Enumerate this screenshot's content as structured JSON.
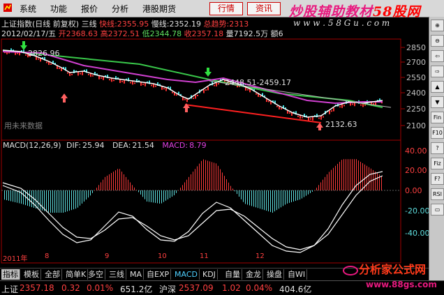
{
  "menu": {
    "items": [
      "系统",
      "功能",
      "报价",
      "分析",
      "港股期货"
    ],
    "buttons": [
      "行情",
      "资讯"
    ]
  },
  "watermark_top": {
    "text": "炒股辅助教材",
    "red": "58股网",
    "url": "w w w . 5 8 G u . c o m"
  },
  "chart_header": {
    "line1": {
      "title": "上证指数(日线 前复权) 三线",
      "l1_label": "快线:",
      "l1_value": "2355.95",
      "l2_label": "慢线:",
      "l2_value": "2352.19",
      "l3_label": "总趋势:",
      "l3_value": "2313"
    },
    "line2": {
      "date": "2012/02/17/五",
      "open_label": "开",
      "open": "2368.63",
      "high_label": "高",
      "high": "2372.51",
      "low_label": "低",
      "low": "2344.78",
      "close_label": "收",
      "close": "2357.18",
      "amt_label": "量",
      "amt": "7192.5万",
      "extra": "额6"
    }
  },
  "price_axis": [
    "2850",
    "2700",
    "2550",
    "2400",
    "2250",
    "2100"
  ],
  "annotations": {
    "top_left": "2826.96",
    "mid": "2448.51-2459.17",
    "low": "2132.63",
    "future": "用未来数据"
  },
  "macd_header": {
    "label": "MACD(12,26,9)",
    "dif_label": "DIF:",
    "dif": "25.94",
    "dea_label": "DEA:",
    "dea": "21.54",
    "macd_label": "MACD:",
    "macd": "8.79"
  },
  "macd_axis": [
    "40.00",
    "20.00",
    "0.00",
    "-20.00",
    "-40.00"
  ],
  "date_axis": [
    "2011年",
    "8",
    "9",
    "10",
    "11",
    "12"
  ],
  "tabs": [
    {
      "label": "指标",
      "active": true
    },
    {
      "label": "模板"
    },
    {
      "label": "全部"
    },
    {
      "label": "简单K"
    },
    {
      "label": "多空"
    },
    {
      "label": "三线"
    },
    {
      "label": "MA"
    },
    {
      "label": "自EXP"
    },
    {
      "label": "MACD",
      "cyan": true
    },
    {
      "label": "KDJ"
    },
    {
      "label": "自量"
    },
    {
      "label": "金龙"
    },
    {
      "label": "操盘"
    },
    {
      "label": "自WI"
    }
  ],
  "status": {
    "sh_label": "上证",
    "sh_val": "2357.18",
    "sh_chg": "0.32",
    "sh_pct": "0.01%",
    "sh_amt": "651.2亿",
    "sz_label": "沪深",
    "sz_val": "2537.09",
    "sz_chg": "1.02",
    "sz_pct": "0.04%",
    "sz_amt": "404.6亿"
  },
  "watermark_bottom": {
    "title": "分析家公式网",
    "url": "www.88gs.com"
  },
  "right_toolbar": [
    "⊕",
    "⊖",
    "⇦",
    "⇨",
    "▲",
    "▼",
    "Fin",
    "F10",
    "?",
    "Fiz",
    "F?",
    "RSI",
    "▭"
  ],
  "colors": {
    "up": "#ff3b3b",
    "down": "#5fe0e0",
    "fast": "#ffffff",
    "slow": "#e040e0",
    "trend": "#39c84a",
    "accent": "#ffff00"
  }
}
